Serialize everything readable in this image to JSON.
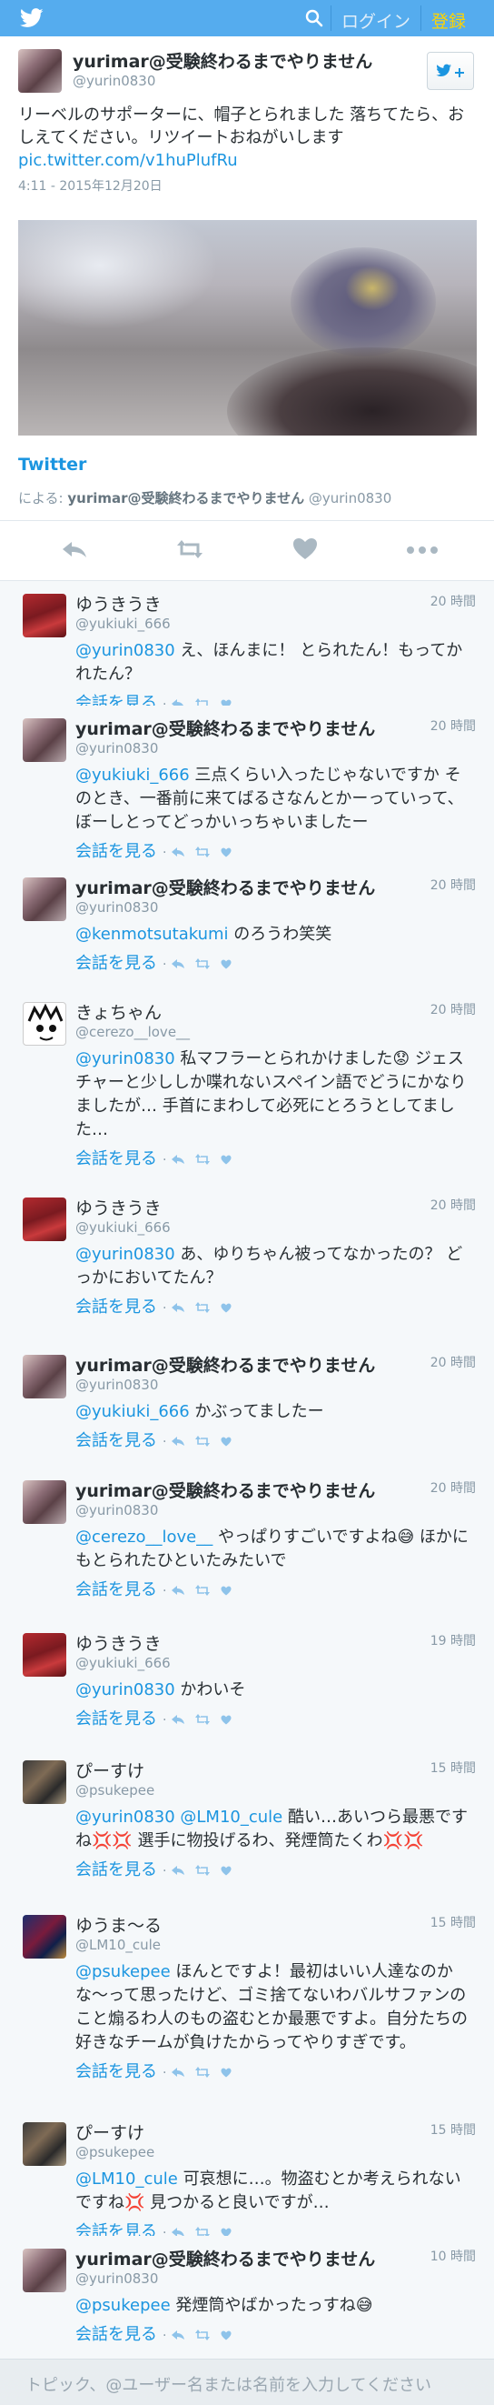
{
  "topbar": {
    "logo_icon": "twitter-bird-icon",
    "search_icon": "search-icon",
    "login_label": "ログイン",
    "signup_label": "登録"
  },
  "tweet": {
    "author_name": "yurimar@受験終わるまでやりません",
    "author_handle": "@yurin0830",
    "follow_icon": "follow-bird-plus-icon",
    "text_plain": "リーベルのサポーターに、帽子とられました 落ちてたら、おしえてください。リツイートおねがいします",
    "link": "pic.twitter.com/v1huPlufRu",
    "timestamp": "4:11 - 2015年12月20日",
    "card_title": "Twitter",
    "via_prefix": "による:",
    "via_name": "yurimar@受験終わるまでやりません",
    "via_handle": "@yurin0830",
    "actions": [
      "reply-icon",
      "retweet-icon",
      "like-heart-icon",
      "more-icon"
    ]
  },
  "colors": {
    "accent": "#55acee",
    "link": "#1b95e0",
    "signup": "#ffd400"
  },
  "replies": [
    {
      "name": "ゆうきうき",
      "handle": "@yukiuki_666",
      "time": "20 時間",
      "mention": "@yurin0830",
      "text": " え、ほんまに！ とられたん！もってかれたん？",
      "footer": "会話を見る"
    },
    {
      "name": "yurimar@受験終わるまでやりません",
      "handle": "@yurin0830",
      "time": "20 時間",
      "mention": "@yukiuki_666",
      "text": " 三点くらい入ったじゃないですか そのとき、一番前に来てばるさなんとかーっていって、ぼーしとってどっかいっちゃいましたー",
      "footer": "会話を見る"
    },
    {
      "name": "yurimar@受験終わるまでやりません",
      "handle": "@yurin0830",
      "time": "20 時間",
      "mention": "@kenmotsutakumi",
      "text": " のろうわ笑笑",
      "footer": "会話を見る"
    },
    {
      "name": "きょちゃん",
      "handle": "@cerezo__love__",
      "time": "20 時間",
      "mention": "@yurin0830",
      "text": " 私マフラーとられかけました😟 ジェスチャーと少ししか喋れないスペイン語でどうにかなりましたが… 手首にまわして必死にとろうとしてました…",
      "footer": "会話を見る"
    },
    {
      "name": "ゆうきうき",
      "handle": "@yukiuki_666",
      "time": "20 時間",
      "mention": "@yurin0830",
      "text": " あ、ゆりちゃん被ってなかったの？ どっかにおいてたん？",
      "footer": "会話を見る"
    },
    {
      "name": "yurimar@受験終わるまでやりません",
      "handle": "@yurin0830",
      "time": "20 時間",
      "mention": "@yukiuki_666",
      "text": " かぶってましたー",
      "footer": "会話を見る"
    },
    {
      "name": "yurimar@受験終わるまでやりません",
      "handle": "@yurin0830",
      "time": "20 時間",
      "mention": "@cerezo__love__",
      "text": " やっぱりすごいですよね😅 ほかにもとられたひといたみたいで",
      "footer": "会話を見る"
    },
    {
      "name": "ゆうきうき",
      "handle": "@yukiuki_666",
      "time": "19 時間",
      "mention": "@yurin0830",
      "text": " かわいそ",
      "footer": "会話を見る"
    },
    {
      "name": "ぴーすけ",
      "handle": "@psukepee",
      "time": "15 時間",
      "mention": "@yurin0830 @LM10_cule",
      "text": " 酷い…あいつら最悪ですね💢💢 選手に物投げるわ、発煙筒たくわ💢💢",
      "footer": "会話を見る"
    },
    {
      "name": "ゆうま〜る",
      "handle": "@LM10_cule",
      "time": "15 時間",
      "mention": "@psukepee",
      "text": " ほんとですよ！最初はいい人達なのかな〜って思ったけど、ゴミ捨てないわバルサファンのこと煽るわ人のもの盗むとか最悪ですよ。自分たちの好きなチームが負けたからってやりすぎです。",
      "footer": "会話を見る"
    },
    {
      "name": "ぴーすけ",
      "handle": "@psukepee",
      "time": "15 時間",
      "mention": "@LM10_cule",
      "text": " 可哀想に…。物盗むとか考えられないですね💢 見つかると良いですが…",
      "footer": "会話を見る"
    },
    {
      "name": "yurimar@受験終わるまでやりません",
      "handle": "@yurin0830",
      "time": "10 時間",
      "mention": "@psukepee",
      "text": " 発煙筒やばかったっすね😅",
      "footer": "会話を見る"
    }
  ],
  "reply_mini_icons": [
    "reply-icon",
    "retweet-icon",
    "like-heart-icon"
  ],
  "composer": {
    "placeholder": "トピック、@ユーザー名または名前を入力してください"
  }
}
